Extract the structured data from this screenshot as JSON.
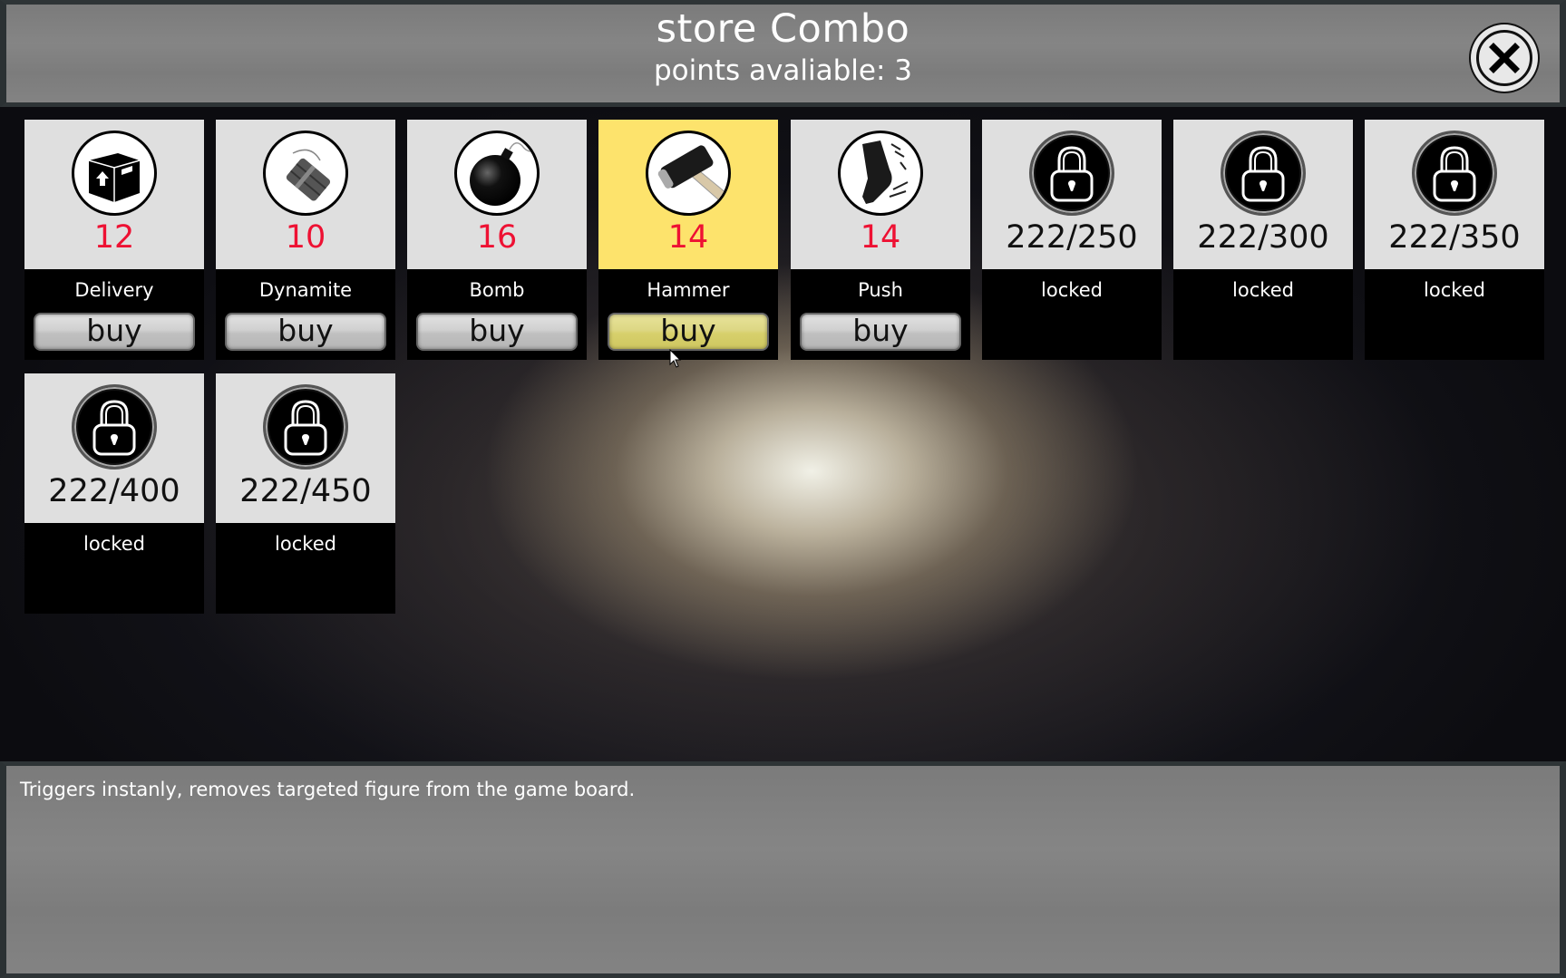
{
  "header": {
    "title": "store Combo",
    "points_label": "points avaliable: 3",
    "close_icon": "close-x-icon"
  },
  "accent_colors": {
    "price": "#ee1133",
    "selected_card": "#fde36c",
    "card_top": "#dfdfdf"
  },
  "items": [
    {
      "name": "Delivery",
      "price": "12",
      "icon": "box-icon",
      "state": "available",
      "button": "buy"
    },
    {
      "name": "Dynamite",
      "price": "10",
      "icon": "dynamite-icon",
      "state": "available",
      "button": "buy"
    },
    {
      "name": "Bomb",
      "price": "16",
      "icon": "bomb-icon",
      "state": "available",
      "button": "buy"
    },
    {
      "name": "Hammer",
      "price": "14",
      "icon": "hammer-icon",
      "state": "selected",
      "button": "buy"
    },
    {
      "name": "Push",
      "price": "14",
      "icon": "boot-icon",
      "state": "available",
      "button": "buy"
    },
    {
      "name": "locked",
      "price": "222/250",
      "icon": "lock-icon",
      "state": "locked"
    },
    {
      "name": "locked",
      "price": "222/300",
      "icon": "lock-icon",
      "state": "locked"
    },
    {
      "name": "locked",
      "price": "222/350",
      "icon": "lock-icon",
      "state": "locked"
    },
    {
      "name": "locked",
      "price": "222/400",
      "icon": "lock-icon",
      "state": "locked"
    },
    {
      "name": "locked",
      "price": "222/450",
      "icon": "lock-icon",
      "state": "locked"
    }
  ],
  "footer": {
    "description": "Triggers instanly, removes targeted figure from the game board."
  }
}
